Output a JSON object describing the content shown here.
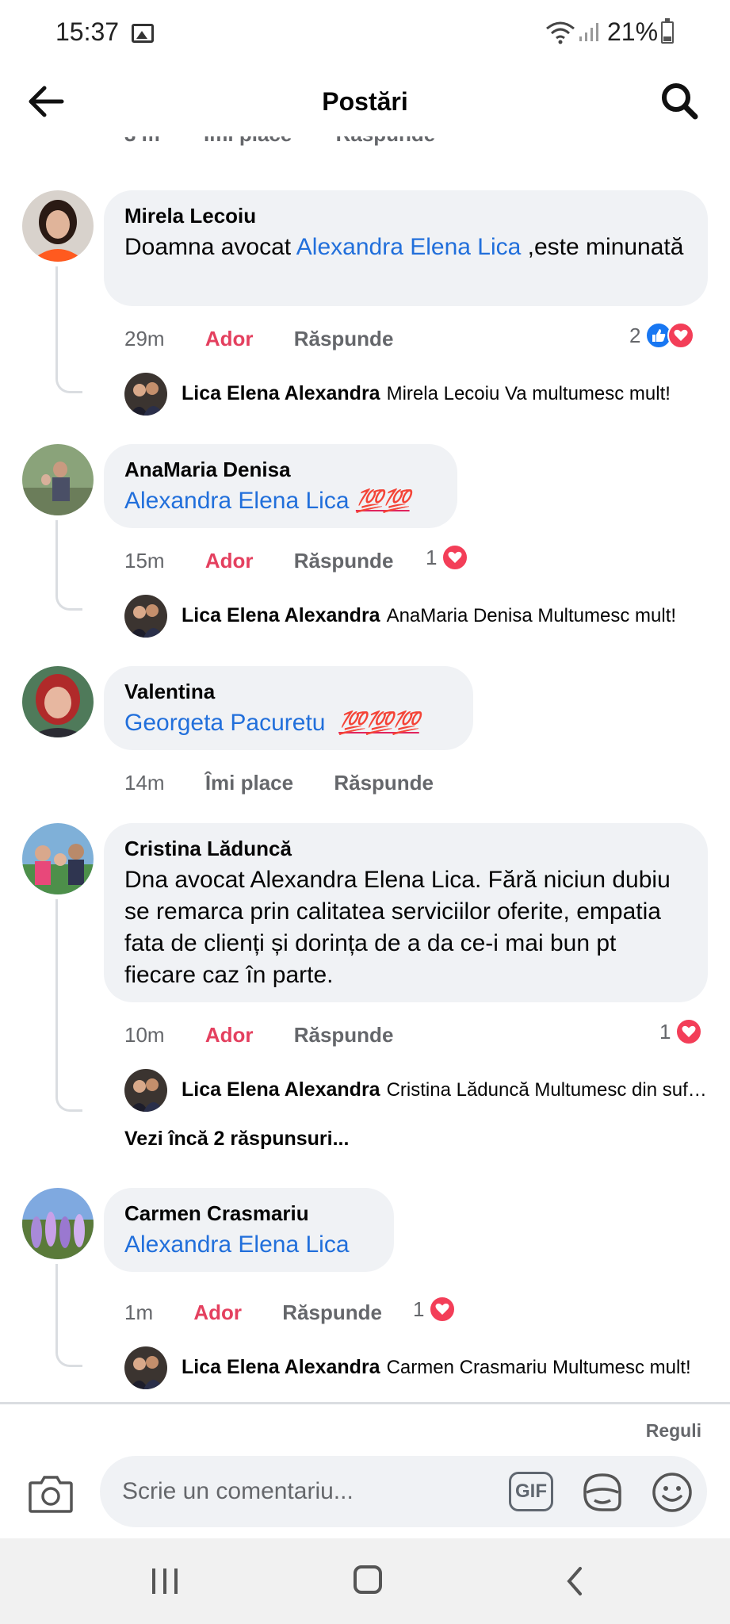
{
  "status_bar": {
    "time": "15:37",
    "battery": "21%"
  },
  "header": {
    "title": "Postări"
  },
  "partial_row": {
    "time": "3 m",
    "like": "Îmi place",
    "reply": "Răspunde"
  },
  "comments": [
    {
      "author": "Mirela Lecoiu",
      "text_before": "Doamna avocat ",
      "mention": "Alexandra Elena Lica",
      "text_after": " ,este minunată",
      "time": "29m",
      "reaction_label": "Ador",
      "reply_label": "Răspunde",
      "reaction_count": "2",
      "reply": {
        "author": "Lica Elena Alexandra",
        "text": "Mirela Lecoiu Va multumesc mult!"
      }
    },
    {
      "author": "AnaMaria Denisa",
      "mention": "Alexandra Elena Lica",
      "emoji": "💯💯",
      "time": "15m",
      "reaction_label": "Ador",
      "reply_label": "Răspunde",
      "reaction_count": "1",
      "reply": {
        "author": "Lica Elena Alexandra",
        "text": "AnaMaria Denisa Multumesc mult!"
      }
    },
    {
      "author": "Valentina",
      "mention": "Georgeta Pacuretu",
      "emoji": "💯💯💯",
      "time": "14m",
      "reaction_label": "Îmi place",
      "reply_label": "Răspunde"
    },
    {
      "author": "Cristina Lăduncă",
      "text": "Dna avocat Alexandra Elena Lica. Fără niciun dubiu se remarca prin calitatea serviciilor oferite, empatia fata de clienți și dorința de a da ce-i mai bun pt fiecare caz în parte.",
      "time": "10m",
      "reaction_label": "Ador",
      "reply_label": "Răspunde",
      "reaction_count": "1",
      "reply": {
        "author": "Lica Elena Alexandra",
        "text": "Cristina Lăduncă Multumesc din suflet!"
      },
      "more_replies": "Vezi încă 2 răspunsuri..."
    },
    {
      "author": "Carmen Crasmariu",
      "mention": "Alexandra Elena Lica",
      "time": "1m",
      "reaction_label": "Ador",
      "reply_label": "Răspunde",
      "reaction_count": "1",
      "reply": {
        "author": "Lica Elena Alexandra",
        "text": "Carmen Crasmariu Multumesc mult!"
      }
    }
  ],
  "composer": {
    "rules": "Reguli",
    "placeholder": "Scrie un comentariu...",
    "gif": "GIF"
  },
  "icons": {
    "back": "arrow-left",
    "search": "magnifier",
    "camera": "camera",
    "sticker": "sticker",
    "emoji": "smiley-face",
    "like": "thumbs-up",
    "love": "heart"
  },
  "colors": {
    "mention": "#216fdb",
    "react": "#e4405f",
    "like": "#1877f2",
    "love": "#f33e58",
    "bubble": "#f0f2f5"
  }
}
